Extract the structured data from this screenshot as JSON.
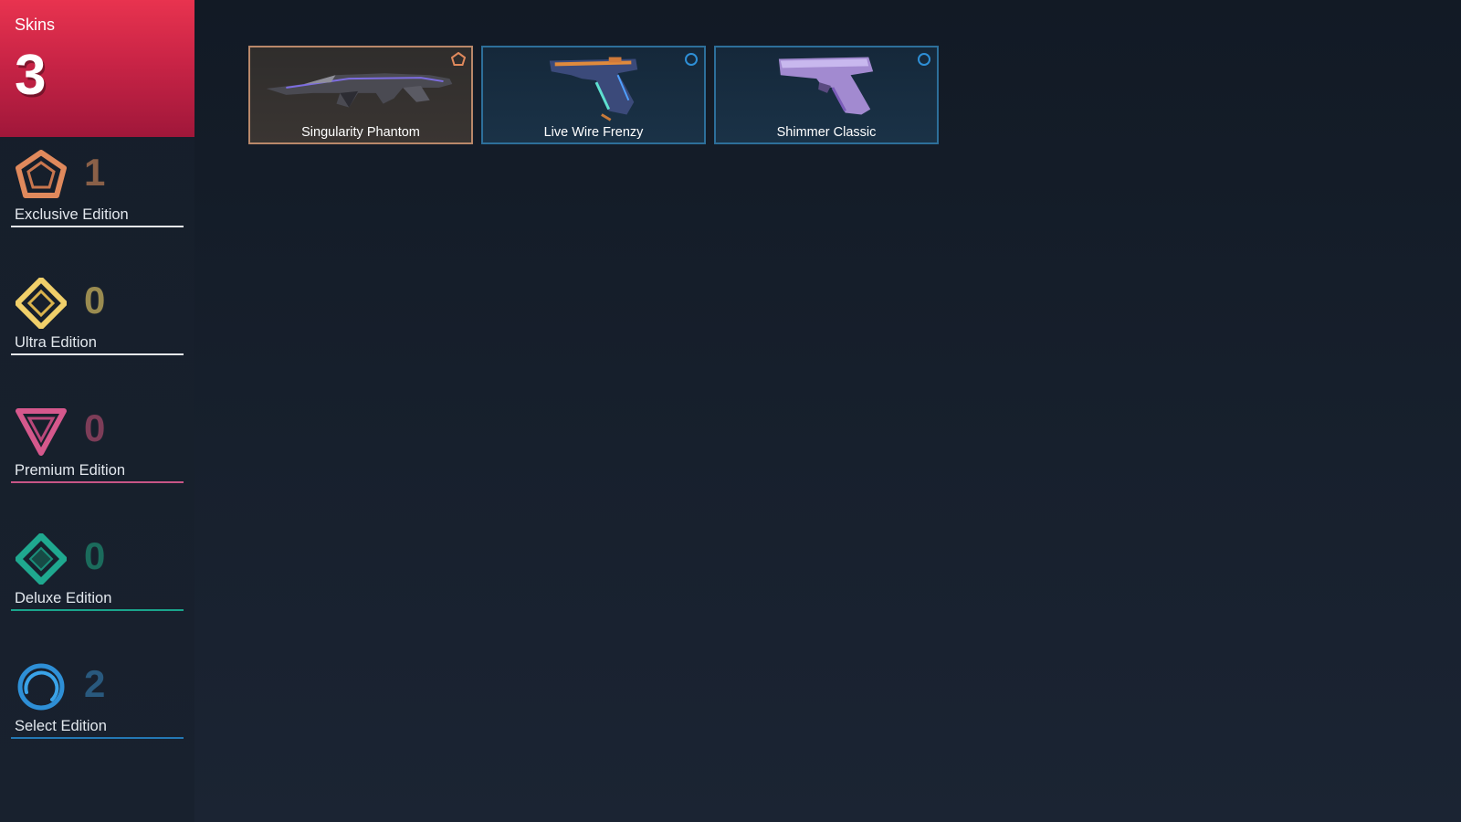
{
  "summary": {
    "label": "Skins",
    "count": "3"
  },
  "tiers": [
    {
      "name": "exclusive",
      "label": "Exclusive Edition",
      "count": "1",
      "icon": "exclusive-pentagon-icon",
      "color": "#e0895c",
      "count_color": "#8a6048"
    },
    {
      "name": "ultra",
      "label": "Ultra Edition",
      "count": "0",
      "icon": "ultra-diamond-icon",
      "color": "#f0cf6a",
      "count_color": "#9a8b50"
    },
    {
      "name": "premium",
      "label": "Premium Edition",
      "count": "0",
      "icon": "premium-triangle-icon",
      "color": "#d5588c",
      "count_color": "#7d3d58"
    },
    {
      "name": "deluxe",
      "label": "Deluxe Edition",
      "count": "0",
      "icon": "deluxe-diamond-icon",
      "color": "#1fa88f",
      "count_color": "#1b6b5c"
    },
    {
      "name": "select",
      "label": "Select Edition",
      "count": "2",
      "icon": "select-circle-icon",
      "color": "#2e8fd6",
      "count_color": "#29597e"
    }
  ],
  "skins": [
    {
      "name": "Singularity Phantom",
      "tier": "exclusive"
    },
    {
      "name": "Live Wire Frenzy",
      "tier": "select"
    },
    {
      "name": "Shimmer Classic",
      "tier": "select"
    }
  ]
}
